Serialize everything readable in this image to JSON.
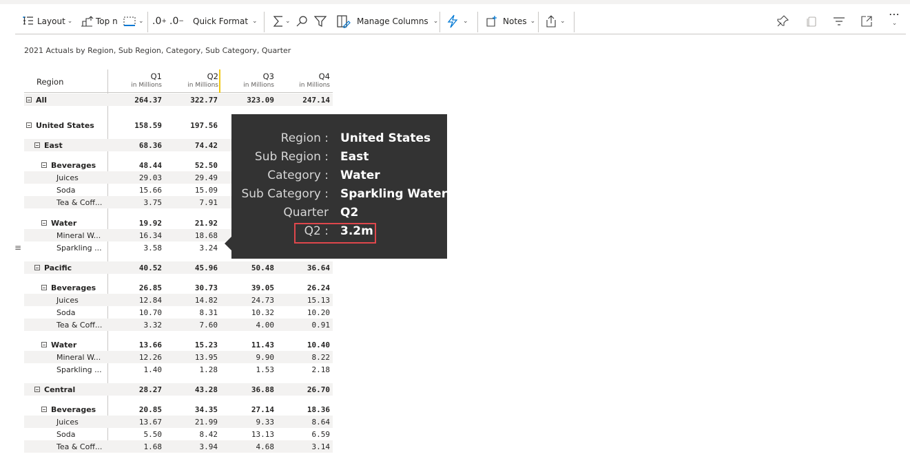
{
  "toolbar": {
    "layout_label": "Layout",
    "topn_label": "Top n",
    "inc_decimal_label": ".0",
    "inc_decimal_sup": "+",
    "dec_decimal_label": ".0",
    "dec_decimal_sup": "−",
    "quick_format_label": "Quick Format",
    "manage_columns_label": "Manage Columns",
    "notes_label": "Notes"
  },
  "subtitle": "2021 Actuals by Region, Sub Region, Category, Sub Category, Quarter",
  "table": {
    "region_header": "Region",
    "quarters": [
      "Q1",
      "Q2",
      "Q3",
      "Q4"
    ],
    "unit_label": "in Millions",
    "rows": [
      {
        "label": "All",
        "v": [
          "264.37",
          "322.77",
          "323.09",
          "247.14"
        ]
      },
      {
        "label": "United States",
        "v": [
          "158.59",
          "197.56",
          "",
          ""
        ]
      },
      {
        "label": "East",
        "v": [
          "68.36",
          "74.42",
          "",
          ""
        ]
      },
      {
        "label": "Beverages",
        "v": [
          "48.44",
          "52.50",
          "",
          ""
        ]
      },
      {
        "label": "Juices",
        "v": [
          "29.03",
          "29.49",
          "",
          ""
        ]
      },
      {
        "label": "Soda",
        "v": [
          "15.66",
          "15.09",
          "",
          ""
        ]
      },
      {
        "label": "Tea & Coff...",
        "v": [
          "3.75",
          "7.91",
          "",
          ""
        ]
      },
      {
        "label": "Water",
        "v": [
          "19.92",
          "21.92",
          "",
          ""
        ]
      },
      {
        "label": "Mineral W...",
        "v": [
          "16.34",
          "18.68",
          "",
          ""
        ]
      },
      {
        "label": "Sparkling ...",
        "v": [
          "3.58",
          "3.24",
          "",
          ""
        ]
      },
      {
        "label": "Pacific",
        "v": [
          "40.52",
          "45.96",
          "50.48",
          "36.64"
        ]
      },
      {
        "label": "Beverages",
        "v": [
          "26.85",
          "30.73",
          "39.05",
          "26.24"
        ]
      },
      {
        "label": "Juices",
        "v": [
          "12.84",
          "14.82",
          "24.73",
          "15.13"
        ]
      },
      {
        "label": "Soda",
        "v": [
          "10.70",
          "8.31",
          "10.32",
          "10.20"
        ]
      },
      {
        "label": "Tea & Coff...",
        "v": [
          "3.32",
          "7.60",
          "4.00",
          "0.91"
        ]
      },
      {
        "label": "Water",
        "v": [
          "13.66",
          "15.23",
          "11.43",
          "10.40"
        ]
      },
      {
        "label": "Mineral W...",
        "v": [
          "12.26",
          "13.95",
          "9.90",
          "8.22"
        ]
      },
      {
        "label": "Sparkling ...",
        "v": [
          "1.40",
          "1.28",
          "1.53",
          "2.18"
        ]
      },
      {
        "label": "Central",
        "v": [
          "28.27",
          "43.28",
          "36.88",
          "26.70"
        ]
      },
      {
        "label": "Beverages",
        "v": [
          "20.85",
          "34.35",
          "27.14",
          "18.36"
        ]
      },
      {
        "label": "Juices",
        "v": [
          "13.67",
          "21.99",
          "9.33",
          "8.64"
        ]
      },
      {
        "label": "Soda",
        "v": [
          "5.50",
          "8.42",
          "13.13",
          "6.59"
        ]
      },
      {
        "label": "Tea & Coff...",
        "v": [
          "1.68",
          "3.94",
          "4.68",
          "3.14"
        ]
      }
    ]
  },
  "tooltip": {
    "region_key": "Region :",
    "region_val": "United States",
    "subregion_key": "Sub Region :",
    "subregion_val": "East",
    "category_key": "Category :",
    "category_val": "Water",
    "subcategory_key": "Sub Category :",
    "subcategory_val": "Sparkling Water",
    "quarter_key": "Quarter",
    "quarter_val": "Q2",
    "measure_key": "Q2 :",
    "measure_val": "3.2m"
  },
  "colors": {
    "highlight_border": "#e0474c",
    "active_column": "#f2c811",
    "tooltip_bg": "#333333"
  }
}
